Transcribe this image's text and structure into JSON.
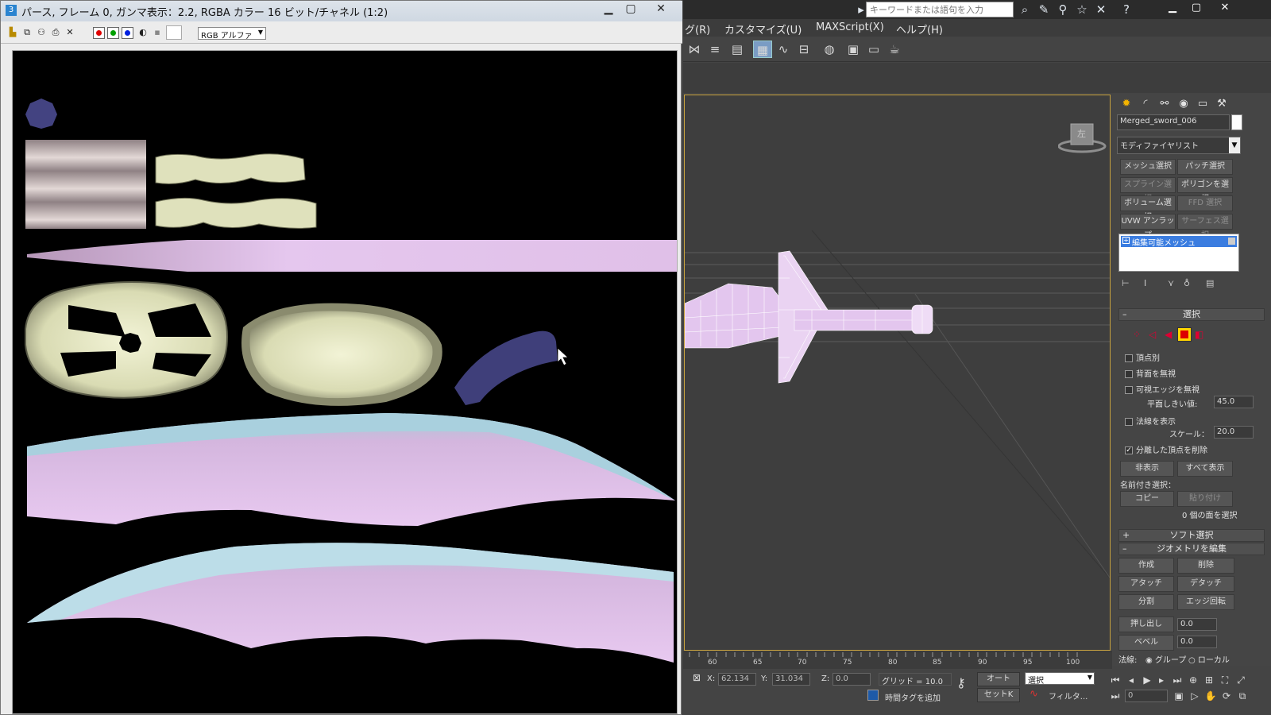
{
  "framebuffer": {
    "title": "パース, フレーム 0, ガンマ表示：2.2, RGBA カラー 16 ビット/チャネル (1:2)",
    "channel_select": "RGB アルファ",
    "channels": [
      {
        "name": "red-channel",
        "color": "#e00000"
      },
      {
        "name": "green-channel",
        "color": "#00a000"
      },
      {
        "name": "blue-channel",
        "color": "#0020e0"
      }
    ]
  },
  "max": {
    "search_placeholder": "キーワードまたは語句を入力",
    "menu": [
      "グ(R)",
      "カスタマイズ(U)",
      "MAXScript(X)",
      "ヘルプ(H)"
    ]
  },
  "command_panel": {
    "object_name": "Merged_sword_006",
    "modifier_list": "モディファイヤリスト",
    "modifier_buttons": [
      {
        "label": "メッシュ選択",
        "dim": false
      },
      {
        "label": "パッチ選択",
        "dim": false
      },
      {
        "label": "スプライン選択",
        "dim": true
      },
      {
        "label": "ポリゴンを選択",
        "dim": false
      },
      {
        "label": "ボリューム選択",
        "dim": false
      },
      {
        "label": "FFD 選択",
        "dim": true
      },
      {
        "label": "UVW アンラップ",
        "dim": false
      },
      {
        "label": "サーフェス選択",
        "dim": true
      }
    ],
    "stack_item": "編集可能メッシュ",
    "selection_rollout": "選択",
    "by_vertex": "頂点別",
    "ignore_backfacing": "背面を無視",
    "ignore_visible_edges": "可視エッジを無視",
    "planar_threshold_label": "平面しきい値:",
    "planar_threshold": "45.0",
    "show_normals": "法線を表示",
    "scale_label": "スケール：",
    "scale": "20.0",
    "delete_isolated": "分離した頂点を削除",
    "hide": "非表示",
    "unhide_all": "すべて表示",
    "named_selections": "名前付き選択：",
    "copy": "コピー",
    "paste": "貼り付け",
    "faces_selected": "0 個の面を選択",
    "soft_selection": "ソフト選択",
    "edit_geometry": "ジオメトリを編集",
    "create": "作成",
    "delete": "削除",
    "attach": "アタッチ",
    "detach": "デタッチ",
    "divide": "分割",
    "turn_edge": "エッジ回転",
    "extrude": "押し出し",
    "extrude_value": "0.0",
    "bevel": "ベベル",
    "bevel_value": "0.0",
    "normal_label": "法線:",
    "group": "グループ",
    "local": "ローカル"
  },
  "viewport": {
    "viewcube_label": "左"
  },
  "timeline": {
    "ticks": [
      "60",
      "65",
      "70",
      "75",
      "80",
      "85",
      "90",
      "95",
      "100"
    ]
  },
  "status": {
    "x_label": "X:",
    "x_value": "62.134",
    "y_label": "Y:",
    "y_value": "31.034",
    "z_label": "Z:",
    "z_value": "0.0",
    "grid": "グリッド = 10.0",
    "add_time_tag": "時間タグを追加",
    "auto_key": "オート",
    "set_key": "セットK",
    "selection_set": "選択",
    "filters": "フィルタ...",
    "frame": "0"
  },
  "colors": {
    "max_bg": "#444444",
    "viewport_border": "#c9a33e",
    "mesh_pink": "#e3c6ee",
    "uv_cream": "#e6e8c4",
    "uv_blue": "#3f3f7a",
    "uv_lightblue": "#bcdde8"
  }
}
